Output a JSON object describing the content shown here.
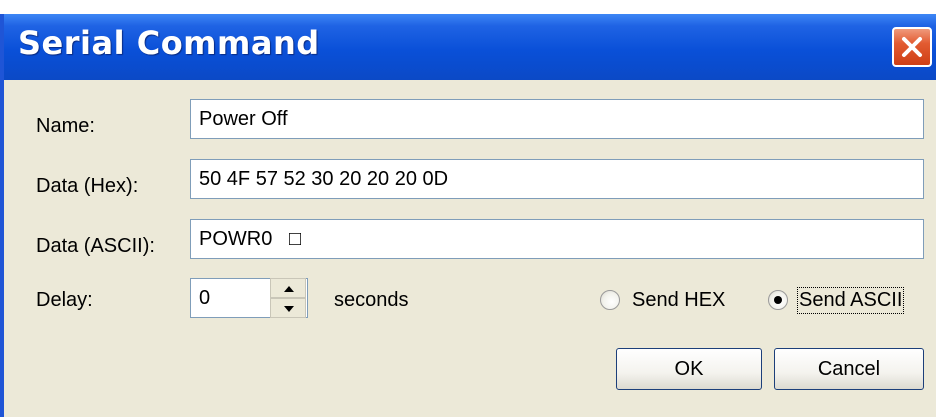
{
  "window": {
    "title": "Serial Command"
  },
  "fields": {
    "name_label": "Name:",
    "name_value": "Power Off",
    "hex_label": "Data (Hex):",
    "hex_value": "50 4F 57 52 30 20 20 20 0D",
    "ascii_label": "Data (ASCII):",
    "ascii_value": "POWR0   □",
    "delay_label": "Delay:",
    "delay_value": "0",
    "delay_unit": "seconds"
  },
  "send_mode": {
    "hex_label": "Send HEX",
    "ascii_label": "Send ASCII",
    "selected": "ascii"
  },
  "buttons": {
    "ok_label": "OK",
    "cancel_label": "Cancel"
  }
}
